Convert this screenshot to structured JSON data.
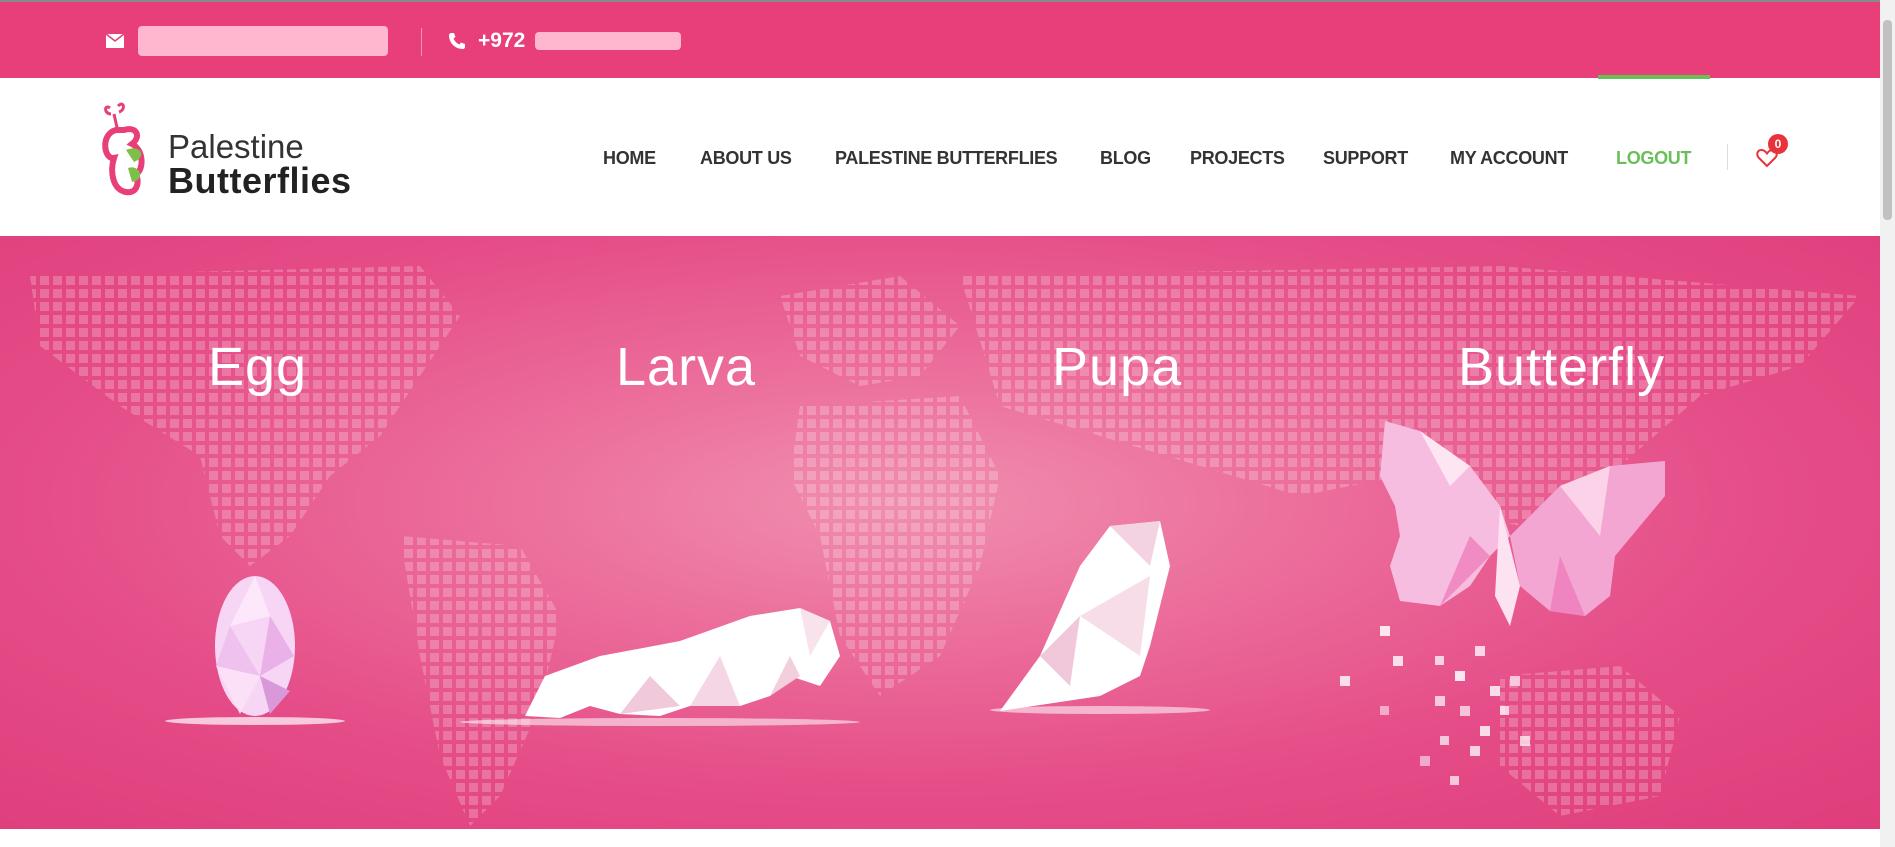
{
  "topbar": {
    "email_icon": "envelope-icon",
    "phone_icon": "phone-icon",
    "phone_prefix": "+972"
  },
  "logo": {
    "line1": "Palestine",
    "line2": "Butterflies"
  },
  "nav": {
    "items": [
      {
        "label": "HOME"
      },
      {
        "label": "ABOUT US"
      },
      {
        "label": "PALESTINE BUTTERFLIES"
      },
      {
        "label": "BLOG"
      },
      {
        "label": "PROJECTS"
      },
      {
        "label": "SUPPORT"
      },
      {
        "label": "MY ACCOUNT"
      },
      {
        "label": "LOGOUT",
        "active": true
      }
    ],
    "wishlist_icon": "heart-icon",
    "wishlist_count": "0"
  },
  "hero": {
    "stages": [
      {
        "label": "Egg"
      },
      {
        "label": "Larva"
      },
      {
        "label": "Pupa"
      },
      {
        "label": "Butterfly"
      }
    ]
  },
  "colors": {
    "brand_pink": "#e83e79",
    "active_green": "#6bbf59",
    "badge_red": "#e8333b"
  }
}
